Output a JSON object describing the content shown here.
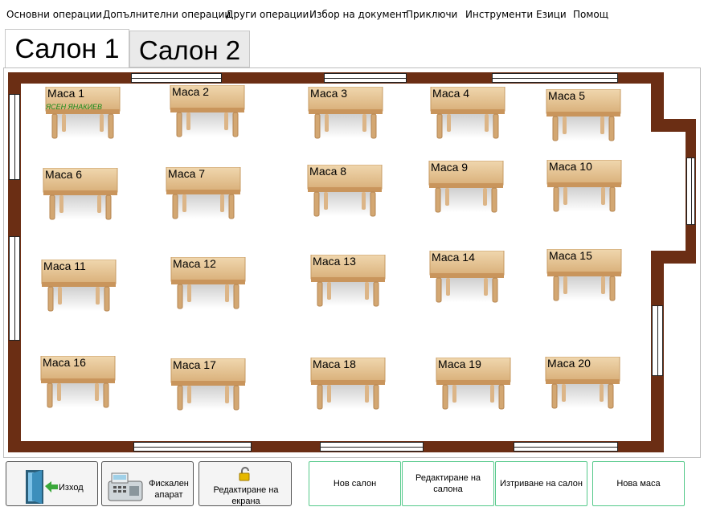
{
  "menu": [
    "Основни операции",
    "Допълнителни операции",
    "Други операции",
    "Избор на документ",
    "Приключи",
    "Инструменти",
    "Езици",
    "Помощ"
  ],
  "tabs": [
    "Салон 1",
    "Салон 2"
  ],
  "tables": [
    {
      "label": "Маса 1",
      "waiter": "ЯСЕН ЯНАКИЕВ"
    },
    {
      "label": "Маса 2"
    },
    {
      "label": "Маса 3"
    },
    {
      "label": "Маса 4"
    },
    {
      "label": "Маса 5"
    },
    {
      "label": "Маса 6"
    },
    {
      "label": "Маса 7"
    },
    {
      "label": "Маса 8"
    },
    {
      "label": "Маса 9"
    },
    {
      "label": "Маса 10"
    },
    {
      "label": "Маса 11"
    },
    {
      "label": "Маса 12"
    },
    {
      "label": "Маса 13"
    },
    {
      "label": "Маса 14"
    },
    {
      "label": "Маса 15"
    },
    {
      "label": "Маса 16"
    },
    {
      "label": "Маса 17"
    },
    {
      "label": "Маса 18"
    },
    {
      "label": "Маса 19"
    },
    {
      "label": "Маса 20"
    }
  ],
  "buttons": {
    "exit": "Изход",
    "fiscal": "Фискален апарат",
    "edit_screen": "Редактиране на екрана",
    "new_hall": "Нов салон",
    "edit_hall": "Редактиране на салона",
    "delete_hall": "Изтриване на салон",
    "new_table": "Нова маса"
  },
  "colors": {
    "wall": "#6b2e14",
    "table_wood": "#e6c79a",
    "waiter_text": "#1a8a1a",
    "green_border": "#55c98a"
  }
}
